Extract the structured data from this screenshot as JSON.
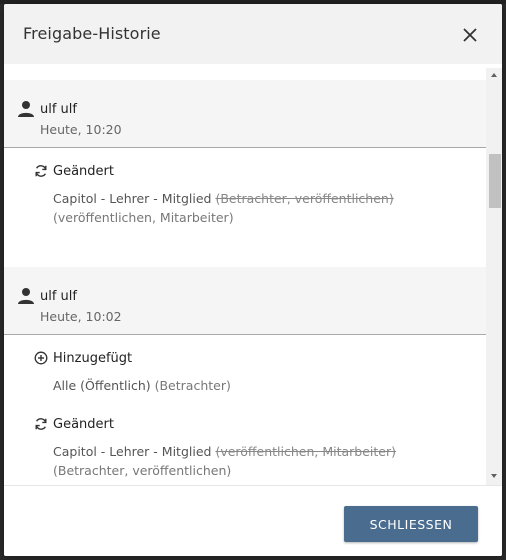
{
  "dialog": {
    "title": "Freigabe-Historie",
    "close_button": "SCHLIESSEN"
  },
  "entries": [
    {
      "user": "ulf ulf",
      "time": "Heute, 10:20",
      "changes": [
        {
          "type": "Geändert",
          "icon": "refresh-icon",
          "target": "Capitol - Lehrer - Mitglied",
          "old": "(Betrachter, veröffentlichen)",
          "new": "(veröffentlichen, Mitarbeiter)"
        }
      ]
    },
    {
      "user": "ulf ulf",
      "time": "Heute, 10:02",
      "changes": [
        {
          "type": "Hinzugefügt",
          "icon": "plus-circle-icon",
          "target": "Alle (Öffentlich)",
          "new": "(Betrachter)"
        },
        {
          "type": "Geändert",
          "icon": "refresh-icon",
          "target": "Capitol - Lehrer - Mitglied",
          "old": "(veröffentlichen, Mitarbeiter)",
          "new": "(Betrachter, veröffentlichen)"
        }
      ]
    }
  ],
  "colors": {
    "header_bg": "#f2f2f2",
    "entry_head_bg": "#f5f5f5",
    "button_bg": "#4a6c8f",
    "button_text": "#ffffff"
  }
}
